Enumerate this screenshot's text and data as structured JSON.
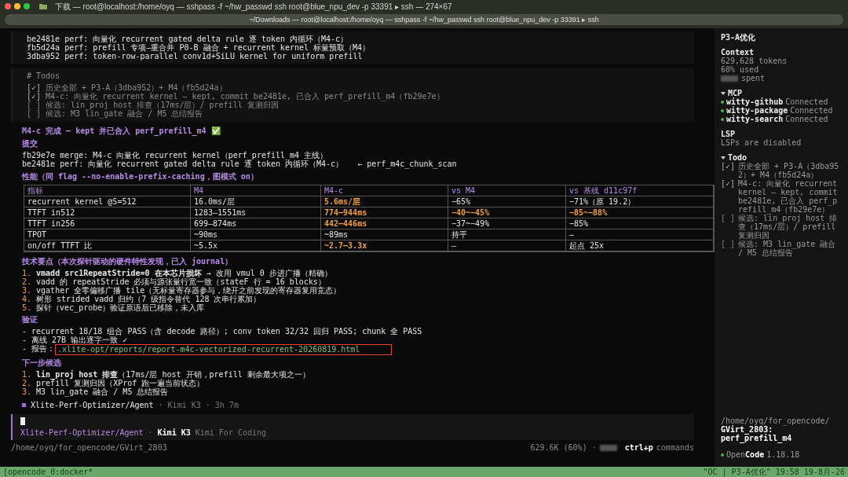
{
  "window": {
    "title": "下载 — root@localhost:/home/oyq — sshpass -f ~/hw_passwd ssh root@blue_npu_dev -p 33391 ▸ ssh — 274×67"
  },
  "tab": {
    "label": "~/Downloads — root@localhost:/home/oyq — sshpass -f ~/hw_passwd ssh root@blue_npu_dev -p 33391 ▸ ssh"
  },
  "commits": [
    "be2481e perf: 向量化 recurrent gated delta rule 逐 token 内循环（M4-c）",
    "fb5d24a perf: prefill 专项—重合并 P0-B 融合 + recurrent kernel 标量预取（M4）",
    "3dba952 perf: token-row-parallel conv1d+SiLU kernel for uniform prefill"
  ],
  "todos_block": {
    "heading": "# Todos",
    "items": [
      {
        "box": "[✓]",
        "checked": true,
        "text": "历史全部 + P3-A（3dba952）+ M4（fb5d24a）"
      },
      {
        "box": "[✓]",
        "checked": true,
        "text": "M4-c: 向量化 recurrent kernel — kept, commit be2481e, 已合入 perf_prefill_m4（fb29e7e）"
      },
      {
        "box": "[ ]",
        "checked": false,
        "text": "候选: lin_proj host 排查（17ms/层）/ prefill 复测归因"
      },
      {
        "box": "[ ]",
        "checked": false,
        "text": "候选: M3 lin_gate 融合 / M5 总结报告"
      }
    ]
  },
  "summary": "M4-c 完成 — kept 并已合入 perf_prefill_m4 ✅",
  "commit_section": {
    "heading": "提交",
    "lines": [
      "fb29e7e merge: M4-c 向量化 recurrent kernel（perf_prefill_m4 主线）",
      "be2481e perf: 向量化 recurrent gated delta rule 逐 token 内循环（M4-c）   ← perf_m4c_chunk_scan"
    ]
  },
  "perf_heading": "性能（同 flag --no-enable-prefix-caching，图模式 on）",
  "table": {
    "columns": [
      "指标",
      "M4",
      "M4-c",
      "vs M4",
      "vs 基线 d11c97f"
    ],
    "rows": [
      {
        "cells": [
          {
            "text": "recurrent kernel @S=512",
            "highlight": false
          },
          {
            "text": "16.0ms/层",
            "highlight": false
          },
          {
            "text": "5.6ms/层",
            "highlight": true
          },
          {
            "text": "−65%",
            "highlight": false
          },
          {
            "text": "−71%（原 19.2）",
            "highlight": false
          }
        ]
      },
      {
        "cells": [
          {
            "text": "TTFT in512",
            "highlight": false
          },
          {
            "text": "1283–1551ms",
            "highlight": false
          },
          {
            "text": "774–944ms",
            "highlight": true
          },
          {
            "text": "−40~−45%",
            "highlight": true
          },
          {
            "text": "−85~−88%",
            "highlight": true
          }
        ]
      },
      {
        "cells": [
          {
            "text": "TTFT in256",
            "highlight": false
          },
          {
            "text": "699–874ms",
            "highlight": false
          },
          {
            "text": "442–446ms",
            "highlight": true
          },
          {
            "text": "−37~−49%",
            "highlight": false
          },
          {
            "text": "−85%",
            "highlight": false
          }
        ]
      },
      {
        "cells": [
          {
            "text": "TPOT",
            "highlight": false
          },
          {
            "text": "~90ms",
            "highlight": false
          },
          {
            "text": "~89ms",
            "highlight": false
          },
          {
            "text": "持平",
            "highlight": false
          },
          {
            "text": "—",
            "highlight": false
          }
        ]
      },
      {
        "cells": [
          {
            "text": "on/off TTFT 比",
            "highlight": false
          },
          {
            "text": "~5.5x",
            "highlight": false
          },
          {
            "text": "~2.7–3.3x",
            "highlight": true
          },
          {
            "text": "—",
            "highlight": false
          },
          {
            "text": "起点 25x",
            "highlight": false
          }
        ]
      }
    ]
  },
  "tech": {
    "heading": "技术要点（本次探针驱动的硬件特性发现，已入 journal）",
    "items": [
      {
        "number": "1.",
        "text": "**vmadd src1RepeatStride=0 在本芯片损坏** → 改用 vmul 0 步进广播（精确）"
      },
      {
        "number": "2.",
        "text": "vadd 的 repeatStride 必须与源张量行宽一致（stateF 行 = 16 blocks）"
      },
      {
        "number": "3.",
        "text": "vgather 全零偏移广播 tile（无标量寄存器参与，绕开之前发现的寄存器复用竞态）"
      },
      {
        "number": "4.",
        "text": "树形 strided vadd 归约（7 级指令替代 128 次串行累加）"
      },
      {
        "number": "5.",
        "text": "探针（vec_probe）验证原语后已移除，未入库"
      }
    ]
  },
  "verify": {
    "heading": "验证",
    "lines": [
      "- recurrent 18/18 组合 PASS（含 decode 路径）; conv token 32/32 回归 PASS; chunk 全 PASS",
      "- 离线 27B 输出逐字一致 ✓"
    ],
    "report_prefix": "- 报告：",
    "report_link": ".xlite-opt/reports/report-m4c-vectorized-recurrent-20260819.html"
  },
  "next": {
    "heading": "下一步候选",
    "items": [
      {
        "number": "1.",
        "text": "**lin_proj host 排查**（17ms/层 host 开销，prefill 剩余最大项之一）"
      },
      {
        "number": "2.",
        "text": "prefill 复测归因（XProf 跑一遍当前状态）"
      },
      {
        "number": "3.",
        "text": "M3 lin_gate 融合 / M5 总结报告"
      }
    ]
  },
  "agent_line": {
    "agent": "Xlite-Perf-Optimizer/Agent",
    "meta": "· Kimi K3 · 3h 7m"
  },
  "input": {
    "agent": "Xlite-Perf-Optimizer/Agent",
    "separator": "·",
    "model": "Kimi K3",
    "provider": "Kimi For Coding"
  },
  "footer": {
    "path": "/home/oyq/for_opencode/GVirt_2803",
    "usage": "629.6K (60%) ·",
    "key": "ctrl+p",
    "key_label": "commands"
  },
  "sidebar": {
    "title": "P3-A优化",
    "context": {
      "heading": "Context",
      "tokens": "629,628 tokens",
      "used": "60% used",
      "spent": "spent"
    },
    "mcp": {
      "heading": "MCP",
      "expanded": true,
      "servers": [
        {
          "name": "witty-github",
          "status": "Connected",
          "color": "#4caf50"
        },
        {
          "name": "witty-package",
          "status": "Connected",
          "color": "#4caf50"
        },
        {
          "name": "witty-search",
          "status": "Connected",
          "color": "#4caf50"
        }
      ]
    },
    "lsp": {
      "heading": "LSP",
      "text": "LSPs are disabled"
    },
    "todo": {
      "heading": "Todo",
      "expanded": true,
      "items": [
        {
          "box": "[✓]",
          "checked": true,
          "text": "历史全部 + P3-A（3dba952）+ M4（fb5d24a）"
        },
        {
          "box": "[✓]",
          "checked": true,
          "text": "M4-c: 向量化 recurrent kernel — kept, commit be2481e, 已合入 perf_prefill_m4（fb29e7e）"
        },
        {
          "box": "[ ]",
          "checked": false,
          "text": "候选: lin_proj host 排查（17ms/层）/ prefill 复测归因"
        },
        {
          "box": "[ ]",
          "checked": false,
          "text": "候选: M3 lin_gate 融合 / M5 总结报告"
        }
      ]
    },
    "path_dir": "/home/oyq/for_opencode/",
    "path_name": "GVirt_2803:",
    "branch": "perf_prefill_m4",
    "app": {
      "name_first": "Open",
      "name_second": "Code",
      "version": "1.18.18"
    }
  },
  "status_bar": {
    "left": "[opencode_0:docker*",
    "right": "\"OC | P3-A优化\" 19:58 19-8月-26"
  }
}
